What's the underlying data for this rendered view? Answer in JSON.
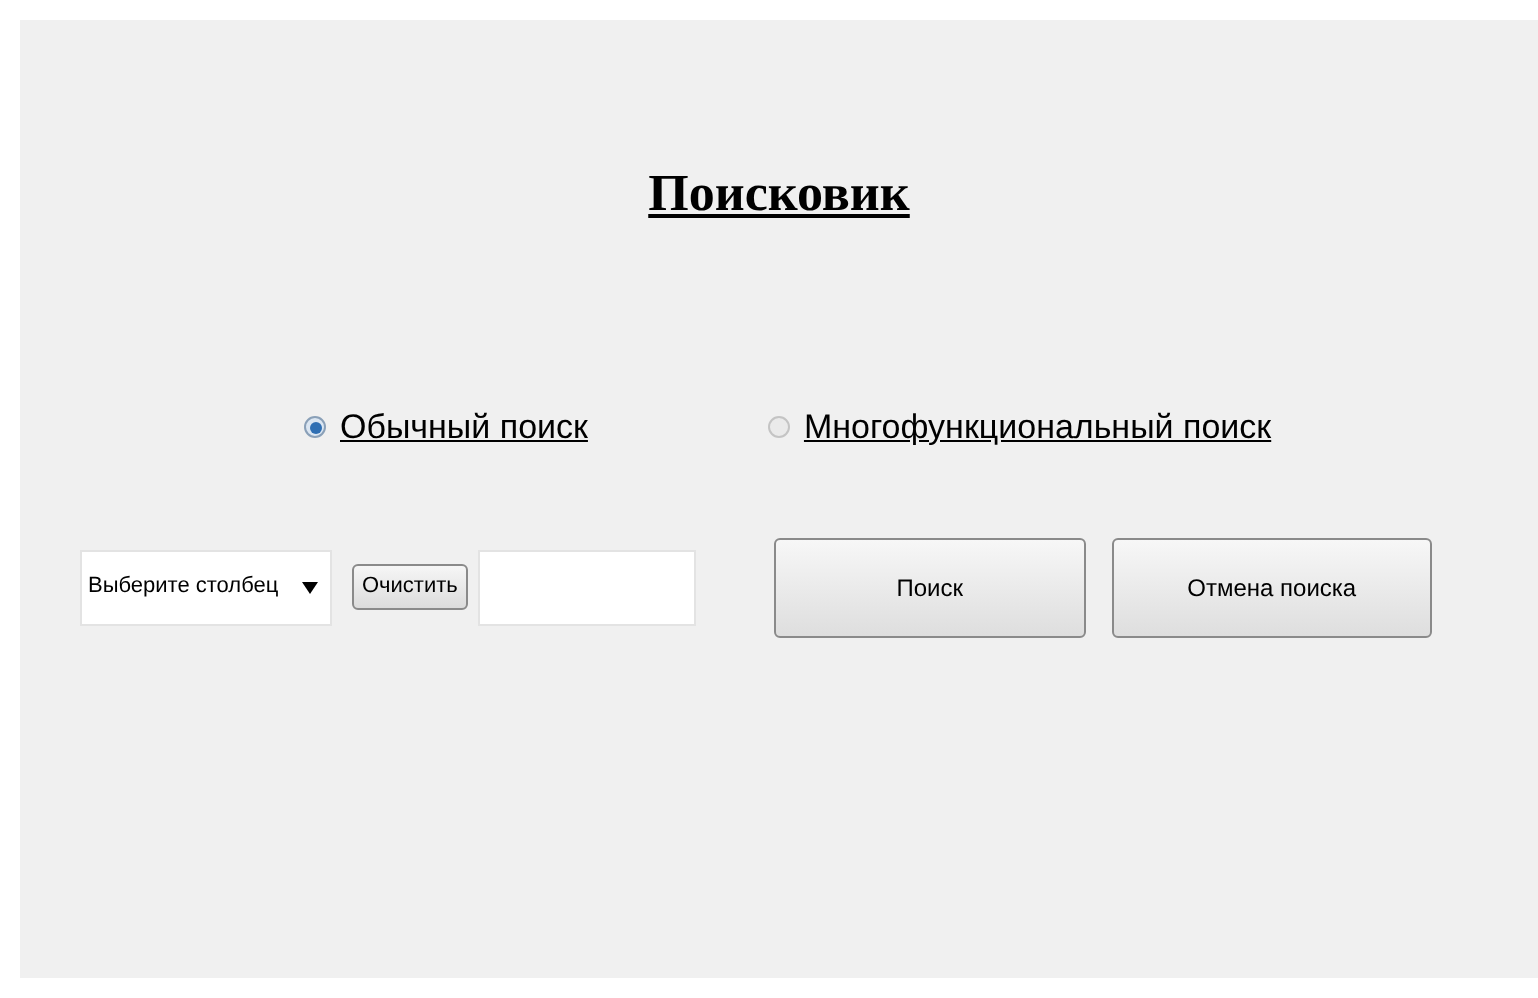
{
  "title": "Поисковик",
  "search_modes": [
    {
      "label": "Обычный поиск",
      "selected": true
    },
    {
      "label": "Многофункциональный поиск",
      "selected": false
    }
  ],
  "column_select": {
    "value": "Выберите столбец"
  },
  "clear_button": "Очистить",
  "buttons": [
    "Поиск",
    "Отмена поиска"
  ]
}
